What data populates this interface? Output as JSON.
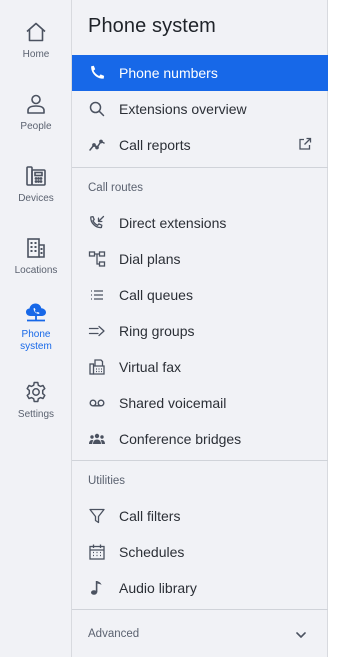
{
  "rail": {
    "items": [
      {
        "label": "Home",
        "icon": "home-icon"
      },
      {
        "label": "People",
        "icon": "person-icon"
      },
      {
        "label": "Devices",
        "icon": "desk-phone-icon"
      },
      {
        "label": "Locations",
        "icon": "building-icon"
      },
      {
        "label": "Phone system",
        "label_line1": "Phone",
        "label_line2": "system",
        "icon": "cloud-phone-icon",
        "active": true
      },
      {
        "label": "Settings",
        "icon": "gear-icon"
      }
    ]
  },
  "panel": {
    "title": "Phone system",
    "top_items": [
      {
        "label": "Phone numbers",
        "icon": "phone-icon",
        "active": true
      },
      {
        "label": "Extensions overview",
        "icon": "search-icon"
      },
      {
        "label": "Call reports",
        "icon": "line-chart-icon",
        "external": true
      }
    ],
    "call_routes": {
      "label": "Call routes",
      "items": [
        {
          "label": "Direct extensions",
          "icon": "phone-incoming-icon"
        },
        {
          "label": "Dial plans",
          "icon": "flow-icon"
        },
        {
          "label": "Call queues",
          "icon": "list-icon"
        },
        {
          "label": "Ring groups",
          "icon": "arrow-group-icon"
        },
        {
          "label": "Virtual fax",
          "icon": "fax-icon"
        },
        {
          "label": "Shared voicemail",
          "icon": "voicemail-icon"
        },
        {
          "label": "Conference bridges",
          "icon": "group-icon"
        }
      ]
    },
    "utilities": {
      "label": "Utilities",
      "items": [
        {
          "label": "Call filters",
          "icon": "filter-icon"
        },
        {
          "label": "Schedules",
          "icon": "calendar-icon"
        },
        {
          "label": "Audio library",
          "icon": "music-note-icon"
        }
      ]
    },
    "advanced": {
      "label": "Advanced",
      "icon": "chevron-down-icon"
    }
  },
  "colors": {
    "accent": "#1768e8",
    "rail_bg": "#f1f2f6",
    "text": "#2b2f36",
    "muted": "#5b6270"
  }
}
